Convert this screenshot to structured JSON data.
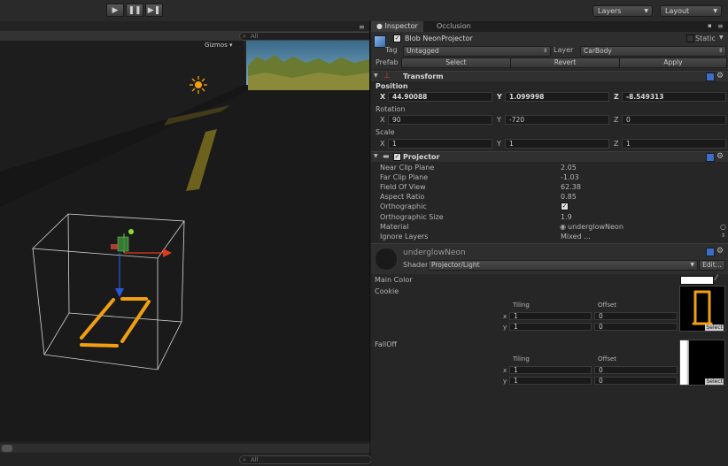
{
  "toolbar": {
    "play_icon": "play-icon",
    "pause_icon": "pause-icon",
    "step_icon": "step-icon",
    "layers_label": "Layers",
    "layout_label": "Layout"
  },
  "scene": {
    "gizmos_label": "Gizmos",
    "search_placeholder": "All",
    "bottom_search_placeholder": "All"
  },
  "inspector": {
    "tabs": [
      {
        "label": "Inspector"
      },
      {
        "label": "Occlusion"
      }
    ],
    "object": {
      "name": "Blob NeonProjector",
      "static_label": "Static",
      "tag_label": "Tag",
      "tag_value": "Untagged",
      "layer_label": "Layer",
      "layer_value": "CarBody",
      "prefab_label": "Prefab",
      "prefab_select": "Select",
      "prefab_revert": "Revert",
      "prefab_apply": "Apply"
    },
    "transform": {
      "title": "Transform",
      "position_label": "Position",
      "position": {
        "x": "44.90088",
        "y": "1.099998",
        "z": "-8.549313"
      },
      "rotation_label": "Rotation",
      "rotation": {
        "x": "90",
        "y": "-720",
        "z": "0"
      },
      "scale_label": "Scale",
      "scale": {
        "x": "1",
        "y": "1",
        "z": "1"
      },
      "axis_x": "X",
      "axis_y": "Y",
      "axis_z": "Z"
    },
    "projector": {
      "title": "Projector",
      "props": [
        {
          "label": "Near Clip Plane",
          "value": "2.05"
        },
        {
          "label": "Far Clip Plane",
          "value": "-1.03"
        },
        {
          "label": "Field Of View",
          "value": "62.38"
        },
        {
          "label": "Aspect Ratio",
          "value": "0.85"
        },
        {
          "label": "Orthographic",
          "value": "✓"
        },
        {
          "label": "Orthographic Size",
          "value": "1.9"
        },
        {
          "label": "Material",
          "value": "underglowNeon"
        },
        {
          "label": "Ignore Layers",
          "value": "Mixed ..."
        }
      ]
    },
    "material": {
      "name": "underglowNeon",
      "shader_label": "Shader",
      "shader_value": "Projector/Light",
      "edit_label": "Edit...",
      "main_color_label": "Main Color",
      "cookie_label": "Cookie",
      "falloff_label": "FallOff",
      "tiling_label": "Tiling",
      "offset_label": "Offset",
      "x_label": "x",
      "y_label": "y",
      "cookie_tiling": {
        "x": "1",
        "y": "1"
      },
      "cookie_offset": {
        "x": "0",
        "y": "0"
      },
      "falloff_tiling": {
        "x": "1",
        "y": "1"
      },
      "falloff_offset": {
        "x": "0",
        "y": "0"
      },
      "select_label": "Select",
      "select_label_2": "Select"
    }
  },
  "colors": {
    "neon": "#f0a010",
    "arrow_red": "#e03a1a",
    "arrow_blue": "#2a58d8",
    "handle_green": "#4ac02a"
  }
}
